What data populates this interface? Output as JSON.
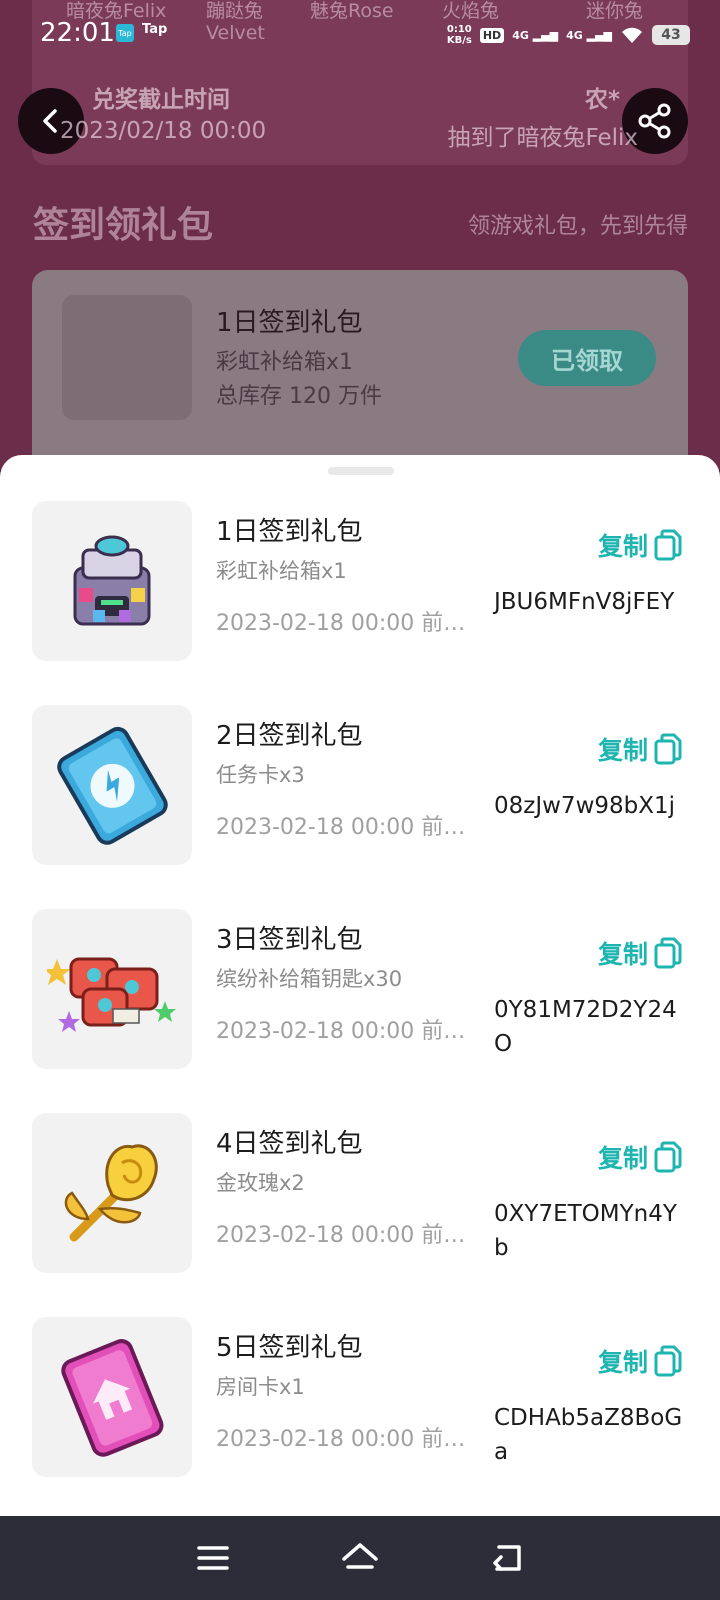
{
  "status_bar": {
    "time": "22:01",
    "app1": "Tap",
    "app2": "Tap",
    "net_speed_top": "0:10",
    "net_speed_bottom": "KB/s",
    "hd": "HD",
    "signal1": "4G",
    "signal2": "4G",
    "battery": "43"
  },
  "background": {
    "rabbit_names": [
      "暗夜兔Felix",
      "蹦跶兔",
      "魅兔Rose",
      "火焰兔",
      "迷你兔"
    ],
    "rabbit_sub": "Velvet",
    "deadline_label": "兑奖截止时间",
    "deadline_date": "2023/02/18 00:00",
    "winner_name": "农*",
    "winner_text": "抽到了暗夜兔Felix",
    "section_title": "签到领礼包",
    "section_subtitle": "领游戏礼包，先到先得",
    "gift": {
      "name": "1日签到礼包",
      "item": "彩虹补给箱x1",
      "stock": "总库存 120 万件",
      "claimed_label": "已领取"
    }
  },
  "sheet": {
    "gifts": [
      {
        "name": "1日签到礼包",
        "item": "彩虹补给箱x1",
        "deadline": "2023-02-18 00:00 前…",
        "copy_label": "复制",
        "code": "JBU6MFnV8jFEY",
        "icon": "rainbow-supply-box-icon"
      },
      {
        "name": "2日签到礼包",
        "item": "任务卡x3",
        "deadline": "2023-02-18 00:00 前…",
        "copy_label": "复制",
        "code": "08zJw7w98bX1j",
        "icon": "task-card-icon"
      },
      {
        "name": "3日签到礼包",
        "item": "缤纷补给箱钥匙x30",
        "deadline": "2023-02-18 00:00 前…",
        "copy_label": "复制",
        "code": "0Y81M72D2Y24O",
        "icon": "supply-box-keys-icon"
      },
      {
        "name": "4日签到礼包",
        "item": "金玫瑰x2",
        "deadline": "2023-02-18 00:00 前…",
        "copy_label": "复制",
        "code": "0XY7ETOMYn4Yb",
        "icon": "golden-rose-icon"
      },
      {
        "name": "5日签到礼包",
        "item": "房间卡x1",
        "deadline": "2023-02-18 00:00 前…",
        "copy_label": "复制",
        "code": "CDHAb5aZ8BoGa",
        "icon": "room-card-icon"
      }
    ]
  },
  "colors": {
    "accent": "#1eb4b0",
    "bg_overlay": "#6b2d4a",
    "navbar": "#2d2d3a"
  }
}
